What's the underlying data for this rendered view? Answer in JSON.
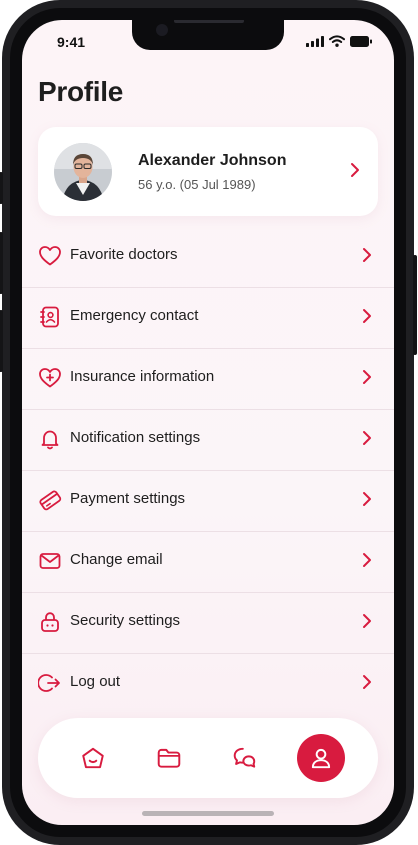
{
  "status_bar": {
    "time": "9:41"
  },
  "page": {
    "title": "Profile"
  },
  "profile": {
    "name": "Alexander Johnson",
    "age_dob": "56 y.o. (05 Jul 1989)"
  },
  "menu": [
    {
      "label": "Favorite doctors",
      "icon": "heart-icon"
    },
    {
      "label": "Emergency contact",
      "icon": "contact-book-icon"
    },
    {
      "label": "Insurance information",
      "icon": "heart-plus-icon"
    },
    {
      "label": "Notification settings",
      "icon": "bell-icon"
    },
    {
      "label": "Payment settings",
      "icon": "card-icon"
    },
    {
      "label": "Change email",
      "icon": "envelope-icon"
    },
    {
      "label": "Security settings",
      "icon": "lock-icon"
    },
    {
      "label": "Log out",
      "icon": "logout-icon"
    }
  ],
  "bottom_nav": [
    {
      "icon": "home-icon",
      "active": false
    },
    {
      "icon": "folder-icon",
      "active": false
    },
    {
      "icon": "chat-icon",
      "active": false
    },
    {
      "icon": "user-icon",
      "active": true
    }
  ],
  "colors": {
    "accent": "#d81b3f",
    "text": "#1e1e1e",
    "background": "#fdf4f7"
  }
}
